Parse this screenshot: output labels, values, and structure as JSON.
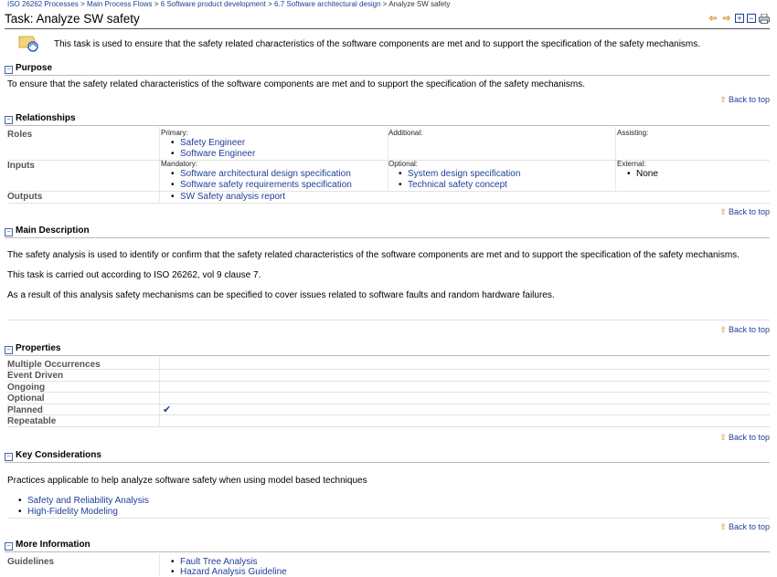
{
  "breadcrumb": {
    "items": [
      "ISO 26262 Processes",
      "Main Process Flows",
      "6 Software product development",
      "6.7 Software architectural design"
    ],
    "separator": ">",
    "current": "Analyze SW safety"
  },
  "page": {
    "title": "Task: Analyze SW safety",
    "intro": "This task is used to ensure that the safety related characteristics of the software components are met and to support the specification of the safety mechanisms."
  },
  "toolbar": {
    "icons": [
      "arrow-left-icon",
      "arrow-right-icon",
      "expand-all-icon",
      "collapse-all-icon",
      "print-icon"
    ]
  },
  "back_to_top": "Back to top",
  "purpose": {
    "heading": "Purpose",
    "text": "To ensure that the safety related characteristics of the software components are met and to support the specification of the safety mechanisms."
  },
  "relationships": {
    "heading": "Relationships",
    "roles": {
      "label": "Roles",
      "primary_label": "Primary:",
      "primary": [
        "Safety Engineer",
        "Software Engineer"
      ],
      "additional_label": "Additional:",
      "assisting_label": "Assisting:"
    },
    "inputs": {
      "label": "Inputs",
      "mandatory_label": "Mandatory:",
      "mandatory": [
        "Software architectural design specification",
        "Software safety requirements specification"
      ],
      "optional_label": "Optional:",
      "optional": [
        "System design specification",
        "Technical safety concept"
      ],
      "external_label": "External:",
      "external": [
        "None"
      ]
    },
    "outputs": {
      "label": "Outputs",
      "items": [
        "SW Safety analysis report"
      ]
    }
  },
  "main_description": {
    "heading": "Main Description",
    "paragraphs": [
      "The safety analysis is used to identify or confirm that the safety related characteristics of the software components are met and to support the specification of the safety mechanisms.",
      "This task is carried out according to ISO 26262, vol 9 clause 7.",
      "As a result of this analysis safety mechanisms can be specified to cover issues related to software faults and random hardware failures."
    ]
  },
  "properties": {
    "heading": "Properties",
    "rows": [
      "Multiple Occurrences",
      "Event Driven",
      "Ongoing",
      "Optional",
      "Planned",
      "Repeatable"
    ],
    "planned_check": "✔"
  },
  "key_considerations": {
    "heading": "Key Considerations",
    "text": "Practices applicable to help analyze software safety when using model based techniques",
    "links": [
      "Safety and Reliability Analysis",
      "High-Fidelity Modeling"
    ]
  },
  "more_information": {
    "heading": "More Information",
    "guidelines_label": "Guidelines",
    "guidelines": [
      "Fault Tree Analysis",
      "Hazard Analysis Guideline"
    ]
  }
}
